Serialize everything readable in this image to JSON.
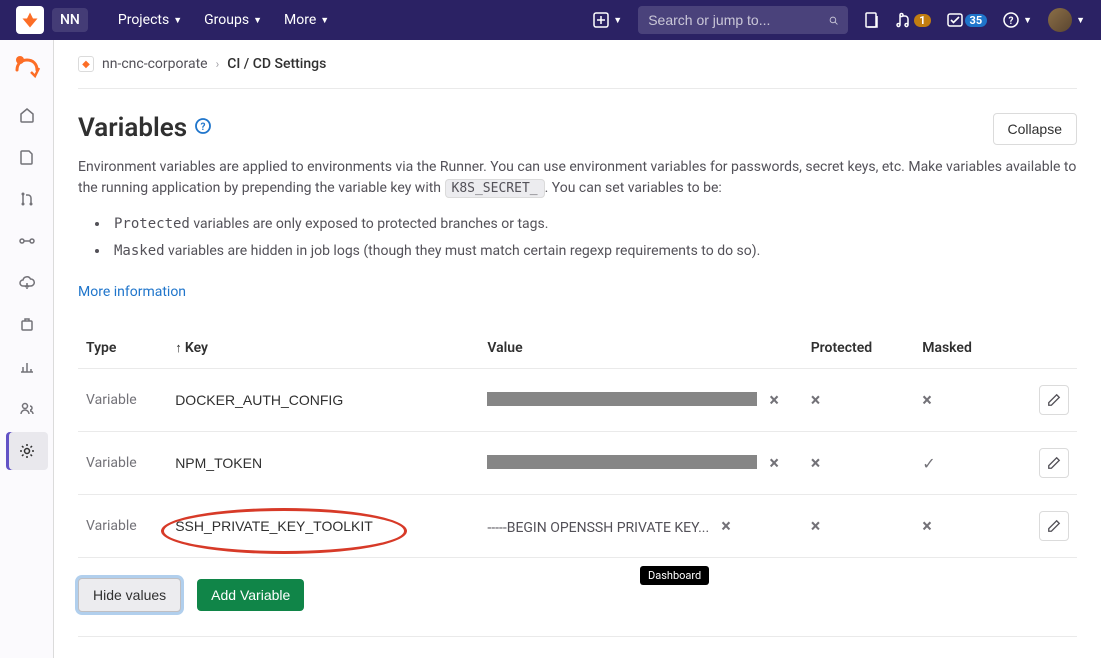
{
  "topnav": {
    "brand": "NN",
    "items": [
      "Projects",
      "Groups",
      "More"
    ],
    "search_placeholder": "Search or jump to...",
    "mr_count": "1",
    "todo_count": "35"
  },
  "breadcrumb": {
    "project": "nn-cnc-corporate",
    "current": "CI / CD Settings"
  },
  "section": {
    "title": "Variables",
    "collapse_label": "Collapse",
    "desc1": "Environment variables are applied to environments via the Runner. You can use environment variables for passwords, secret keys, etc. Make variables available to the running application by prepending the variable key with ",
    "desc1_code": "K8S_SECRET_",
    "desc1_tail": ". You can set variables to be:",
    "bullet1_code": "Protected",
    "bullet1_text": " variables are only exposed to protected branches or tags.",
    "bullet2_code": "Masked",
    "bullet2_text": " variables are hidden in job logs (though they must match certain regexp requirements to do so).",
    "more_info": "More information"
  },
  "table": {
    "headers": {
      "type": "Type",
      "key": "Key",
      "value": "Value",
      "protected": "Protected",
      "masked": "Masked"
    },
    "rows": [
      {
        "type": "Variable",
        "key": "DOCKER_AUTH_CONFIG",
        "value_redacted": true,
        "protected": false,
        "masked": false
      },
      {
        "type": "Variable",
        "key": "NPM_TOKEN",
        "value_redacted": true,
        "protected": false,
        "masked": true
      },
      {
        "type": "Variable",
        "key": "SSH_PRIVATE_KEY_TOOLKIT",
        "value_redacted": false,
        "value_text": "-----BEGIN OPENSSH PRIVATE KEY...",
        "protected": false,
        "masked": false,
        "highlight": true
      }
    ]
  },
  "actions": {
    "hide_values": "Hide values",
    "add_variable": "Add Variable"
  },
  "tooltip": "Dashboard"
}
